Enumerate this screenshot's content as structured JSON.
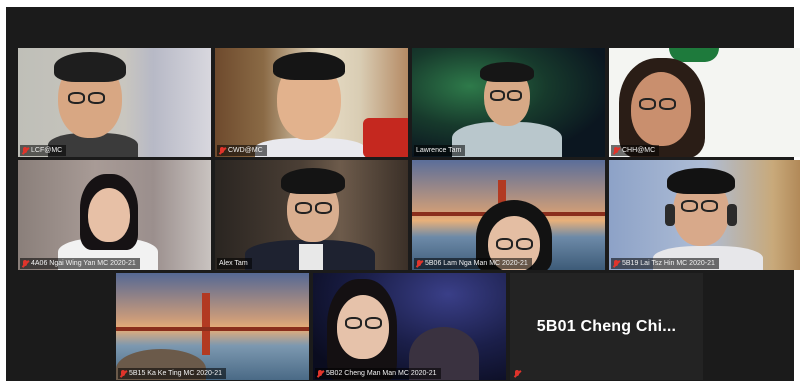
{
  "meeting": {
    "tiles": [
      {
        "id": "t1",
        "label": "LCF@MC",
        "muted": true
      },
      {
        "id": "t2",
        "label": "CWD@MC",
        "muted": true
      },
      {
        "id": "t3",
        "label": "Lawrence Tam",
        "muted": false
      },
      {
        "id": "t4",
        "label": "CHH@MC",
        "muted": true,
        "active_speaker": true
      },
      {
        "id": "t5",
        "label": "4A06 Ngai Wing Yan MC 2020-21",
        "muted": true
      },
      {
        "id": "t6",
        "label": "Alex Tam",
        "muted": false
      },
      {
        "id": "t7",
        "label": "5B06 Lam Nga Man MC 2020-21",
        "muted": true
      },
      {
        "id": "t8",
        "label": "5B19 Lai Tsz Hin MC 2020-21",
        "muted": true
      },
      {
        "id": "t9",
        "label": "5B15 Ka Ke Ting MC 2020-21",
        "muted": true
      },
      {
        "id": "t10",
        "label": "5B02 Cheng Man Man MC 2020-21",
        "muted": true
      },
      {
        "id": "t11",
        "label": "",
        "muted": true,
        "display_name": "5B01  Cheng  Chi..."
      }
    ]
  },
  "colors": {
    "background": "#1b1b1b",
    "active_speaker_border": "#d6ea2a",
    "muted_icon": "#e0342b"
  },
  "icons": {
    "muted": "microphone-muted-icon"
  }
}
